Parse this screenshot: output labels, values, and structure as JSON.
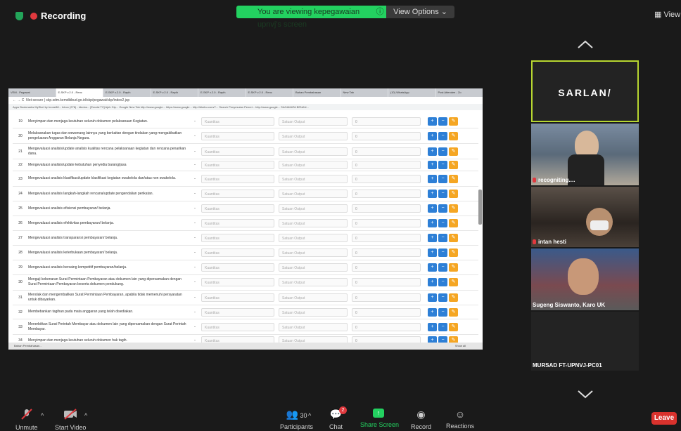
{
  "top": {
    "recording_label": "Recording",
    "share_banner": "You are viewing kepegawaian upnvj's screen",
    "view_options": "View Options",
    "view_button": "View"
  },
  "browser": {
    "tabs": [
      "VEM - Pegawai",
      "E-SKP v.2.0 - Renc",
      "E-SKP v.2.0 - Rapih",
      "E-SKP v.2.0 - Rapih",
      "E-SKP v.2.0 - Rapih",
      "E-SKP v.2.0 - Renc",
      "Bahan Pembahasan",
      "New Tab",
      "(10) WhatsApp",
      "Post Attendee - Zo"
    ],
    "address": "Not secure | skp.sdm.kemdikbud.go.id/skp/pegawai/skp/index2.jsp",
    "bookmarks": "Apps  Bookmarks  MySkel by brone88...  Inbox (278) - kbrdos...  [Emulsi TV] Ajeh Gip...  Google  New Tab  http://www.google...  https://www.google...  http://bkebu.com/?...  Search  Penyesuian Peneri...  http://www.google...  SAGAMATA  BENAN..."
  },
  "table": {
    "qty_placeholder": "Kuantitas",
    "sat_placeholder": "Satuan Output",
    "zero_value": "0",
    "dash": "-",
    "rows": [
      {
        "no": "19",
        "desc": "Menyimpan dan menjaga keutuhan seluruh dokumen pelaksanaan Kegiatan."
      },
      {
        "no": "20",
        "desc": "Melaksanakan tugas dan wewenang lainnya yang berkaitan dengan tindakan yang mengakibatkan pengeluaran Anggaran Belanja Negara."
      },
      {
        "no": "21",
        "desc": "Mengevaluasi analisis/update analisis kualitas rencana pelaksanaan kegiatan dan rencana penarikan dana."
      },
      {
        "no": "22",
        "desc": "Mengevaluasi analisis/update kebutuhan penyedia barang/jasa"
      },
      {
        "no": "23",
        "desc": "Mengevaluasi analisis klasifikasi/update klasifikasi kegiatan swakelola dan/atau non swakelola."
      },
      {
        "no": "24",
        "desc": "Mengevaluasi analisis langkah-langkah rencana/update pengendalian perikatan."
      },
      {
        "no": "25",
        "desc": "Mengevaluasi analisis efisiensi pembayaran/ belanja."
      },
      {
        "no": "26",
        "desc": "Mengevaluasi analisis efektivitas pembayaran/ belanja."
      },
      {
        "no": "27",
        "desc": "Mengevaluasi analisis transparansi pembayaran/ belanja."
      },
      {
        "no": "28",
        "desc": "Mengevaluasi analisis keterbukaan pembayaran/ belanja."
      },
      {
        "no": "29",
        "desc": "Mengevaluasi analisis bersaing kompetitif pembayaran/belanja."
      },
      {
        "no": "30",
        "desc": "Menguji kebenaran Surat Permintaan Pembayaran atau dokumen lain yang dipersamakan dengan Surat Permintaan Pembayaran beserta dokumen pendukung."
      },
      {
        "no": "31",
        "desc": "Menolak dan mengembalikan Surat Permintaan Pembayaran, apabila tidak memenuhi persyaratan untuk dibayarkan."
      },
      {
        "no": "32",
        "desc": "Membebankan tagihan pada mata anggaran yang telah disediakan."
      },
      {
        "no": "33",
        "desc": "Menerbitkan Surat Perintah Membayar atau dokumen lain yang dipersamakan dengan Surat Perintah Membayar."
      },
      {
        "no": "34",
        "desc": "Menyimpan dan menjaga keutuhan seluruh dokumen hak tagih."
      }
    ],
    "btn_add": "+",
    "btn_minus": "−",
    "btn_edit": "✎"
  },
  "taskbar": {
    "text": "Bahan Pembahasan...",
    "show_all": "Show all"
  },
  "participants": {
    "tiles": [
      {
        "name": "SARLAN/"
      },
      {
        "name": "recogniting...."
      },
      {
        "name": "intan hesti"
      },
      {
        "name": "Sugeng Siswanto, Karo UK"
      },
      {
        "name": "MURSAD FT-UPNVJ-PC01"
      }
    ]
  },
  "toolbar": {
    "unmute": "Unmute",
    "start_video": "Start Video",
    "participants": "Participants",
    "participants_count": "30",
    "chat": "Chat",
    "chat_badge": "2",
    "share_screen": "Share Screen",
    "record": "Record",
    "reactions": "Reactions",
    "leave": "Leave"
  },
  "colors": {
    "accent_green": "#23d160",
    "active_speaker": "#b7d630",
    "leave": "#d9322d",
    "share": "#23d160"
  }
}
